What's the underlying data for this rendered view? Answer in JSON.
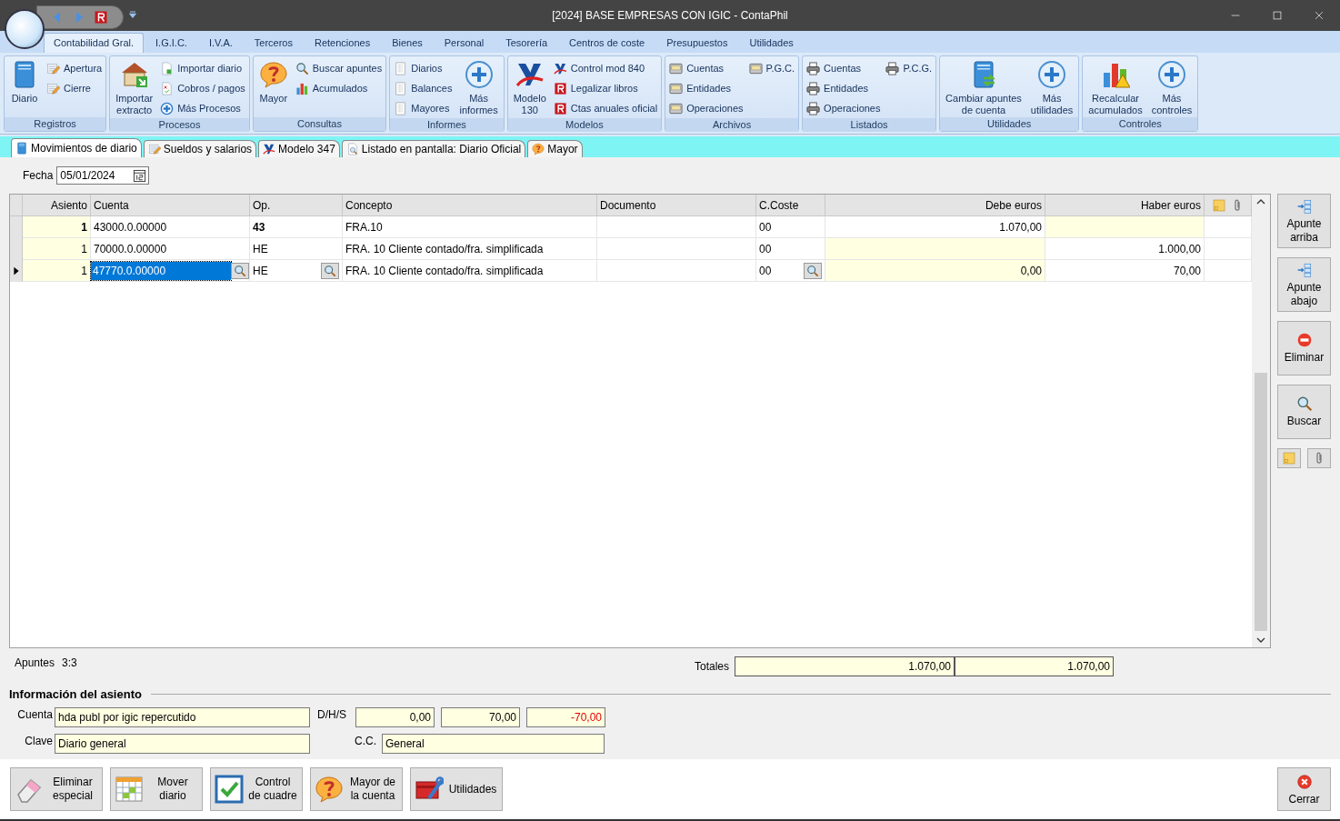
{
  "window": {
    "title": "[2024] BASE EMPRESAS CON IGIC - ContaPhil"
  },
  "ribbon_tabs": [
    {
      "label": "Contabilidad Gral.",
      "selected": true
    },
    {
      "label": "I.G.I.C.",
      "selected": false
    },
    {
      "label": "I.V.A.",
      "selected": false
    },
    {
      "label": "Terceros",
      "selected": false
    },
    {
      "label": "Retenciones",
      "selected": false
    },
    {
      "label": "Bienes",
      "selected": false
    },
    {
      "label": "Personal",
      "selected": false
    },
    {
      "label": "Tesorería",
      "selected": false
    },
    {
      "label": "Centros de coste",
      "selected": false
    },
    {
      "label": "Presupuestos",
      "selected": false
    },
    {
      "label": "Utilidades",
      "selected": false
    }
  ],
  "ribbon_groups": [
    {
      "label": "Registros",
      "columns": [
        [
          {
            "kind": "large",
            "lines": [
              "Diario"
            ]
          }
        ],
        [
          {
            "kind": "small",
            "label": "Apertura"
          },
          {
            "kind": "small",
            "label": "Cierre"
          }
        ]
      ]
    },
    {
      "label": "Procesos",
      "columns": [
        [
          {
            "kind": "large",
            "lines": [
              "Importar",
              "extracto"
            ]
          }
        ],
        [
          {
            "kind": "small",
            "label": "Importar diario"
          },
          {
            "kind": "small",
            "label": "Cobros / pagos"
          },
          {
            "kind": "small",
            "label": "Más Procesos"
          }
        ]
      ]
    },
    {
      "label": "Consultas",
      "columns": [
        [
          {
            "kind": "large",
            "lines": [
              "Mayor"
            ]
          }
        ],
        [
          {
            "kind": "small",
            "label": "Buscar apuntes"
          },
          {
            "kind": "small",
            "label": "Acumulados"
          }
        ]
      ]
    },
    {
      "label": "Informes",
      "columns": [
        [
          {
            "kind": "small",
            "label": "Diarios"
          },
          {
            "kind": "small",
            "label": "Balances"
          },
          {
            "kind": "small",
            "label": "Mayores"
          }
        ],
        [
          {
            "kind": "large",
            "lines": [
              "Más",
              "informes"
            ]
          }
        ]
      ]
    },
    {
      "label": "Modelos",
      "columns": [
        [
          {
            "kind": "large",
            "lines": [
              "Modelo",
              "130"
            ]
          }
        ],
        [
          {
            "kind": "small",
            "label": "Control mod 840"
          },
          {
            "kind": "small",
            "label": "Legalizar libros"
          },
          {
            "kind": "small",
            "label": "Ctas anuales oficial"
          }
        ]
      ]
    },
    {
      "label": "Archivos",
      "columns": [
        [
          {
            "kind": "small",
            "label": "Cuentas"
          },
          {
            "kind": "small",
            "label": "Entidades"
          },
          {
            "kind": "small",
            "label": "Operaciones"
          }
        ],
        [
          {
            "kind": "small",
            "label": "P.G.C."
          }
        ]
      ]
    },
    {
      "label": "Listados",
      "columns": [
        [
          {
            "kind": "small",
            "label": "Cuentas"
          },
          {
            "kind": "small",
            "label": "Entidades"
          },
          {
            "kind": "small",
            "label": "Operaciones"
          }
        ],
        [
          {
            "kind": "small",
            "label": "P.C.G."
          }
        ]
      ]
    },
    {
      "label": "Utilidades",
      "columns": [
        [
          {
            "kind": "large",
            "lines": [
              "Cambiar apuntes",
              "de cuenta"
            ]
          }
        ],
        [
          {
            "kind": "large",
            "lines": [
              "Más",
              "utilidades"
            ]
          }
        ]
      ]
    },
    {
      "label": "Controles",
      "columns": [
        [
          {
            "kind": "large",
            "lines": [
              "Recalcular",
              "acumulados"
            ]
          }
        ],
        [
          {
            "kind": "large",
            "lines": [
              "Más",
              "controles"
            ]
          }
        ]
      ]
    }
  ],
  "document_tabs": [
    {
      "label": "Movimientos de diario",
      "selected": true
    },
    {
      "label": "Sueldos y salarios",
      "selected": false
    },
    {
      "label": "Modelo 347",
      "selected": false
    },
    {
      "label": "Listado en pantalla: Diario Oficial",
      "selected": false
    },
    {
      "label": "Mayor",
      "selected": false
    }
  ],
  "fecha": {
    "label": "Fecha",
    "value": "05/01/2024"
  },
  "table": {
    "columns": [
      "Asiento",
      "Cuenta",
      "Op.",
      "Concepto",
      "Documento",
      "C.Coste",
      "Debe euros",
      "Haber euros"
    ],
    "rows": [
      {
        "asiento": "1",
        "cuenta": "43000.0.00000",
        "op": "43",
        "concepto": "FRA.10",
        "c_coste": "00",
        "debe": "1.070,00",
        "debe_open": false,
        "haber_open": true,
        "bold": true,
        "current": false
      },
      {
        "asiento": "1",
        "cuenta": "70000.0.00000",
        "op": "HE",
        "concepto": "FRA. 10 Cliente contado/fra. simplificada",
        "c_coste": "00",
        "haber": "1.000,00",
        "debe_open": true,
        "haber_open": false,
        "bold": false,
        "current": false
      },
      {
        "asiento": "1",
        "cuenta": "47770.0.00000",
        "op": "HE",
        "concepto": "FRA. 10 Cliente contado/fra. simplificada",
        "c_coste": "00",
        "debe": "0,00",
        "haber": "70,00",
        "debe_open": true,
        "haber_open": false,
        "bold": false,
        "current": true
      }
    ]
  },
  "apuntes": {
    "label": "Apuntes",
    "value": "3:3"
  },
  "totals": {
    "label": "Totales",
    "debe": "1.070,00",
    "haber": "1.070,00"
  },
  "side_buttons": [
    {
      "lines": [
        "Apunte",
        "arriba"
      ]
    },
    {
      "lines": [
        "Apunte",
        "abajo"
      ]
    },
    {
      "lines": [
        "Eliminar"
      ]
    },
    {
      "lines": [
        "Buscar"
      ]
    }
  ],
  "info": {
    "title": "Información del asiento",
    "cuenta_label": "Cuenta",
    "cuenta": "hda publ por igic repercutido",
    "dhs_label": "D/H/S",
    "dhs": [
      {
        "value": "0,00",
        "negative": false
      },
      {
        "value": "70,00",
        "negative": false
      },
      {
        "value": "-70,00",
        "negative": true
      }
    ],
    "clave_label": "Clave",
    "clave": "Diario general",
    "cc_label": "C.C.",
    "cc": "General"
  },
  "bottom_buttons": [
    {
      "lines": [
        "Eliminar",
        "especial"
      ]
    },
    {
      "lines": [
        "Mover",
        "diario"
      ]
    },
    {
      "lines": [
        "Control",
        "de cuadre"
      ]
    },
    {
      "lines": [
        "Mayor de",
        "la cuenta"
      ]
    },
    {
      "lines": [
        "Utilidades"
      ]
    }
  ],
  "close_button": {
    "label": "Cerrar"
  }
}
